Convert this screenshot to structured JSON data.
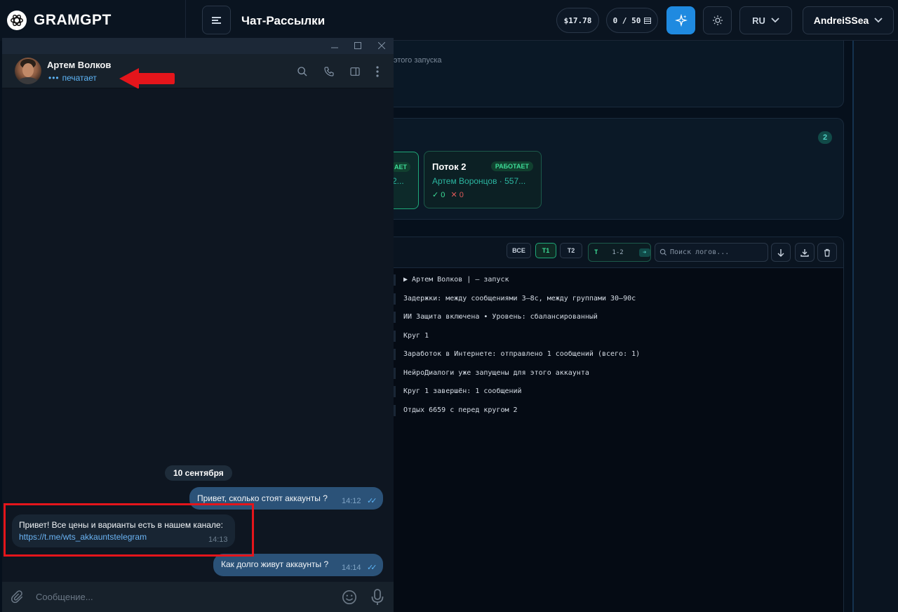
{
  "app": {
    "brand": "GRAMGPT",
    "page_title": "Чат-Рассылки",
    "balance": "$17.78",
    "counter": "0 / 50",
    "language": "RU",
    "user": "AndreiSSea"
  },
  "background": {
    "launch_hint": "этого запуска",
    "streams_count": "2",
    "stream1": {
      "badge": "АЕТ",
      "subtitle": "2..."
    },
    "stream2": {
      "name": "Поток 2",
      "badge": "РАБОТАЕТ",
      "subtitle": "Артем Воронцов · 557...",
      "ok": "✓ 0",
      "err": "✕ 0"
    },
    "logs_toolbar": {
      "all": "ВСЕ",
      "t1": "Т1",
      "t2": "Т2",
      "range_prefix": "Т",
      "range": "1-2",
      "search_placeholder": "Поиск логов..."
    },
    "log_lines": [
      "▶ Артем Волков | — запуск",
      "Задержки: между сообщениями 3–8с, между группами 30–90с",
      "ИИ Защита включена • Уровень: сбалансированный",
      "Круг 1",
      "Заработок в Интернете: отправлено 1 сообщений (всего: 1)",
      "НейроДиалоги уже запущены для этого аккаунта",
      "Круг 1 завершён: 1 сообщений",
      "Отдых 6659 с перед кругом 2"
    ]
  },
  "telegram": {
    "contact_name": "Артем Волков",
    "status_dots": "•••",
    "status": "печатает",
    "date_chip": "10 сентября",
    "messages": [
      {
        "text": "Привет, сколько стоят аккаунты ?",
        "time": "14:12",
        "ticks": "✓✓"
      },
      {
        "text": "Привет! Все цены и варианты есть в нашем канале:",
        "link": "https://t.me/wts_akkauntstelegram",
        "time": "14:13"
      },
      {
        "text": "Как долго живут аккаунты ?",
        "time": "14:14",
        "ticks": "✓✓"
      }
    ],
    "input_placeholder": "Сообщение..."
  },
  "colors": {
    "accent": "#1f8ae0",
    "annotation": "#e4151b",
    "working": "#3ddc97"
  }
}
